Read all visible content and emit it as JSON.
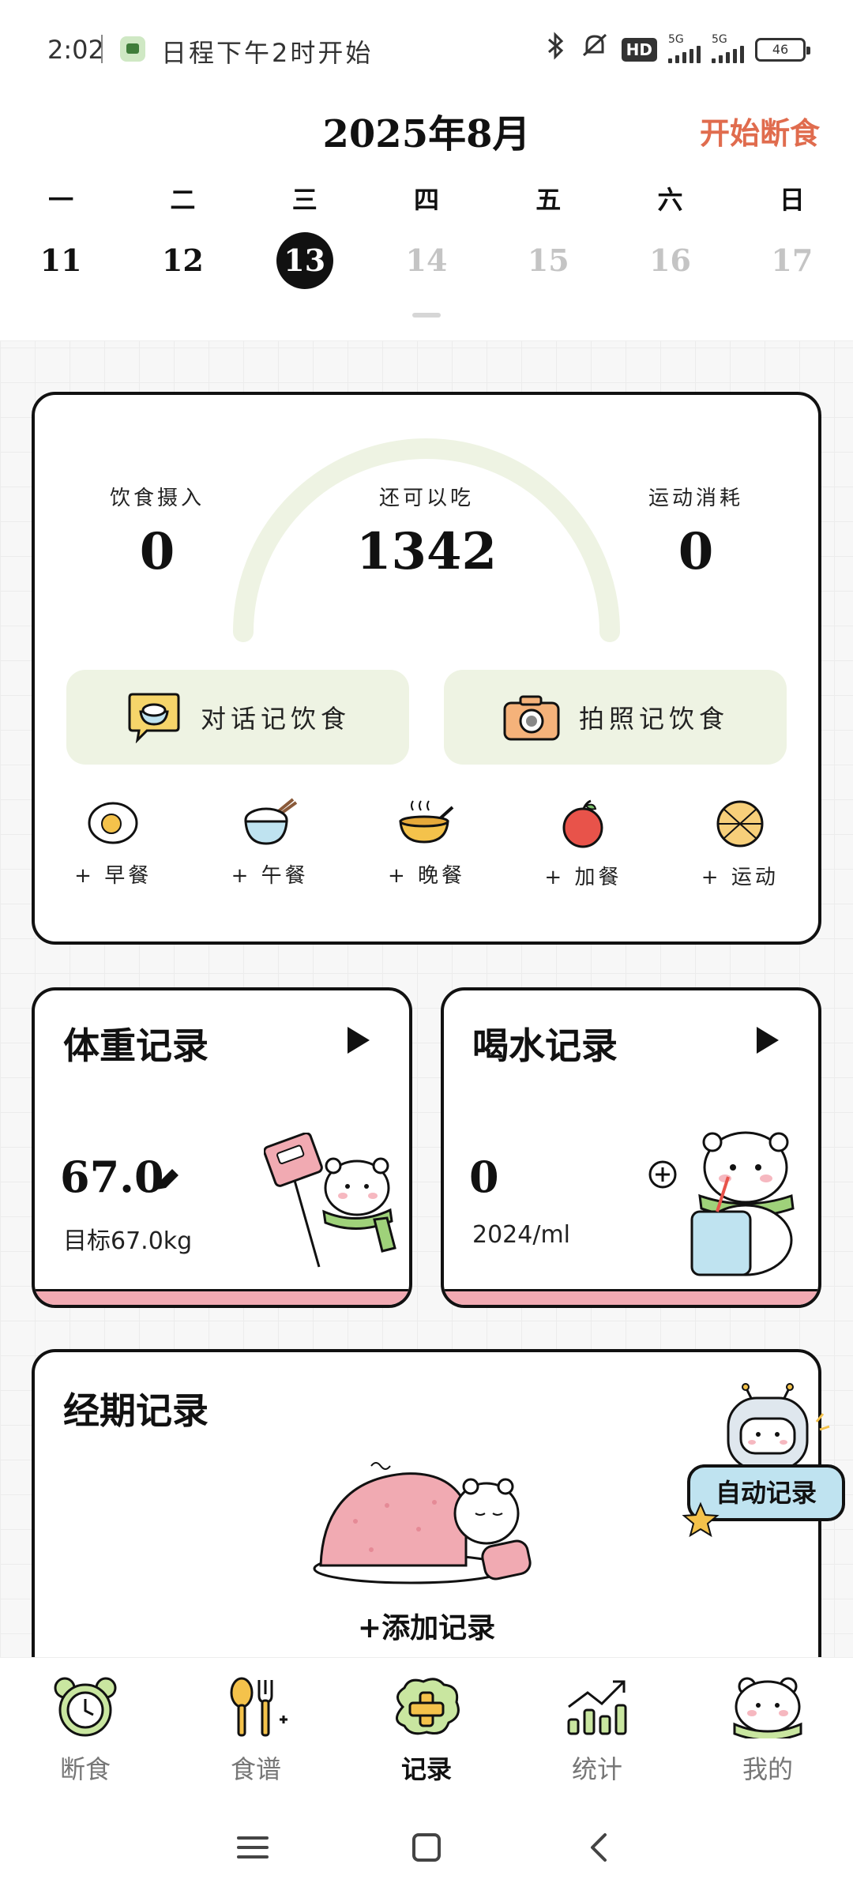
{
  "status_bar": {
    "time": "2:02",
    "notification": "日程下午2时开始",
    "network_label": "5G",
    "hd_label": "HD",
    "battery": "46"
  },
  "header": {
    "title": "2025年8月",
    "start_fast": "开始断食",
    "weekdays": [
      "一",
      "二",
      "三",
      "四",
      "五",
      "六",
      "日"
    ],
    "dates": [
      "11",
      "12",
      "13",
      "14",
      "15",
      "16",
      "17"
    ],
    "selected_index": 2
  },
  "summary": {
    "intake_label": "饮食摄入",
    "intake_value": "0",
    "remaining_label": "还可以吃",
    "remaining_value": "1342",
    "burn_label": "运动消耗",
    "burn_value": "0",
    "chat_log_label": "对话记饮食",
    "photo_log_label": "拍照记饮食",
    "meals": [
      "+ 早餐",
      "+ 午餐",
      "+ 晚餐",
      "+ 加餐",
      "+ 运动"
    ]
  },
  "weight_card": {
    "title": "体重记录",
    "value": "67.0",
    "target": "目标67.0kg"
  },
  "water_card": {
    "title": "喝水记录",
    "value": "0",
    "target": "2024/ml"
  },
  "period_card": {
    "title": "经期记录",
    "add_label": "+添加记录",
    "auto_label": "自动记录"
  },
  "nav": {
    "items": [
      "断食",
      "食谱",
      "记录",
      "统计",
      "我的"
    ],
    "active_index": 2
  },
  "colors": {
    "accent_orange": "#e06c4e",
    "highlight_yellow": "#f6e37a",
    "soft_green": "#eef3e3",
    "pink": "#f1aab2"
  }
}
